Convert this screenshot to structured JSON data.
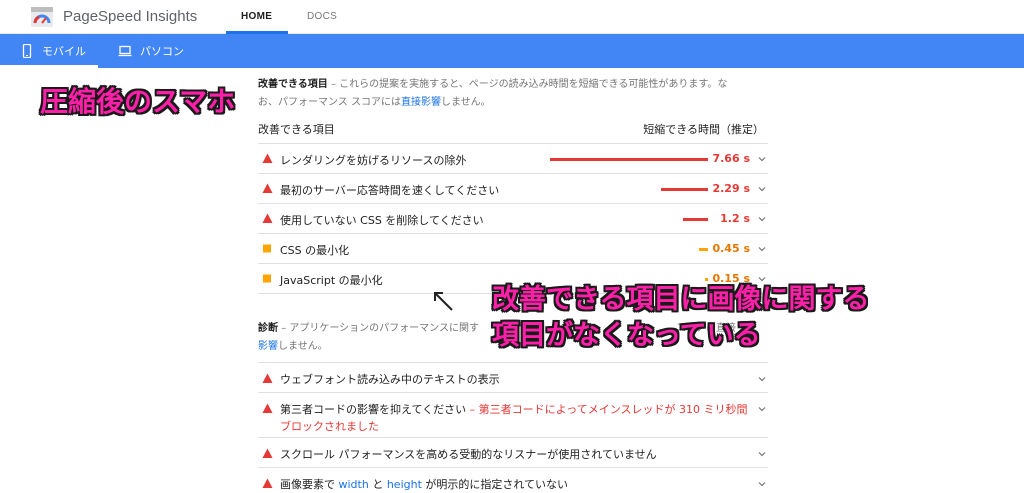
{
  "header": {
    "app_title": "PageSpeed Insights",
    "nav": [
      {
        "label": "HOME",
        "active": true
      },
      {
        "label": "DOCS",
        "active": false
      }
    ]
  },
  "device_tabs": [
    {
      "label": "モバイル",
      "icon": "phone-icon",
      "active": true
    },
    {
      "label": "パソコン",
      "icon": "laptop-icon",
      "active": false
    }
  ],
  "opportunities": {
    "title": "改善できる項目",
    "description_line1": "– これらの提案を実施すると、ページの読み込み時間を短縮できる可能性があります。な",
    "description_line2_prefix": "お、パフォーマンス スコアには",
    "description_link": "直接影響",
    "description_line2_suffix": "しません。",
    "col_item": "改善できる項目",
    "col_savings": "短縮できる時間（推定）",
    "items": [
      {
        "label": "レンダリングを妨げるリソースの除外",
        "value": "7.66 s",
        "severity": "fail",
        "savings": 7.66
      },
      {
        "label": "最初のサーバー応答時間を速くしてください",
        "value": "2.29 s",
        "severity": "fail",
        "savings": 2.29
      },
      {
        "label": "使用していない CSS を削除してください",
        "value": "1.2 s",
        "severity": "fail",
        "savings": 1.2
      },
      {
        "label": "CSS の最小化",
        "value": "0.45 s",
        "severity": "average",
        "savings": 0.45
      },
      {
        "label": "JavaScript の最小化",
        "value": "0.15 s",
        "severity": "average",
        "savings": 0.15
      }
    ]
  },
  "diagnostics": {
    "title": "診断",
    "description_line1": "– アプリケーションのパフォーマンスに関す",
    "description_line1_tail": "スコアに直接",
    "description_link": "影響",
    "description_line2_suffix": "しません。",
    "items": [
      {
        "label": "ウェブフォント読み込み中のテキストの表示",
        "severity": "fail"
      },
      {
        "label": "第三者コードの影響を抑えてください",
        "detail": "– 第三者コードによってメインスレッドが 310 ミリ秒間ブロックされました",
        "severity": "fail"
      },
      {
        "label": "スクロール パフォーマンスを高める受動的なリスナーが使用されていません",
        "severity": "fail"
      },
      {
        "label_prefix": "画像要素で ",
        "code1": "width",
        "label_mid": " と ",
        "code2": "height",
        "label_suffix": " が明示的に指定されていない",
        "severity": "fail"
      }
    ]
  },
  "annotations": {
    "top": "圧縮後のスマホ",
    "mid_line1": "改善できる項目に画像に関する",
    "mid_line2": "項目がなくなっている",
    "arrow": "↖"
  },
  "colors": {
    "accent_blue": "#4285f4",
    "fail_red": "#e53935",
    "average_orange": "#ffa400",
    "annotation_pink": "#ff1fa8"
  }
}
